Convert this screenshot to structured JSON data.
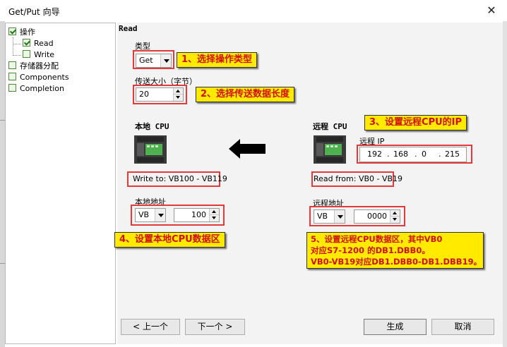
{
  "window": {
    "title": "Get/Put 向导",
    "close_glyph": "✕"
  },
  "tree": {
    "items": [
      {
        "label": "操作",
        "checked": true
      },
      {
        "label": "Read",
        "checked": true
      },
      {
        "label": "Write",
        "checked": false
      },
      {
        "label": "存储器分配",
        "checked": false
      },
      {
        "label": "Components",
        "checked": false
      },
      {
        "label": "Completion",
        "checked": false
      }
    ]
  },
  "page": {
    "heading": "Read",
    "type_label": "类型",
    "type_value": "Get",
    "size_label": "传送大小（字节）",
    "size_value": "20",
    "local_header": "本地 CPU",
    "remote_header": "远程 CPU",
    "arrow_icon": "left-arrow-icon",
    "write_to": "Write to: VB100 - VB119",
    "read_from": "Read from: VB0 - VB19",
    "remote_ip_label": "远程 IP",
    "ip": [
      "192",
      "168",
      "0",
      "215"
    ],
    "ip_sep": ".",
    "local_addr_label": "本地地址",
    "local_area": "VB",
    "local_offset": "100",
    "remote_addr_label": "远程地址",
    "remote_area": "VB",
    "remote_offset": "0000"
  },
  "annotations": {
    "a1": "1、选择操作类型",
    "a2": "2、选择传送数据长度",
    "a3": "3、设置远程CPU的IP",
    "a4": "4、设置本地CPU数据区",
    "a5_line1": "5、设置远程CPU数据区，其中VB0",
    "a5_line2": "对应S7-1200 的DB1.DBB0。",
    "a5_line3": "VB0-VB19对应DB1.DBB0-DB1.DBB19。"
  },
  "buttons": {
    "prev": "< 上一个",
    "next": "下一个 >",
    "finish": "生成",
    "cancel": "取消"
  },
  "colors": {
    "annotation_bg": "#ffea00",
    "annotation_text": "#d01010",
    "highlight_border": "#e23a3a",
    "panel_bg": "#f3f3f3"
  }
}
